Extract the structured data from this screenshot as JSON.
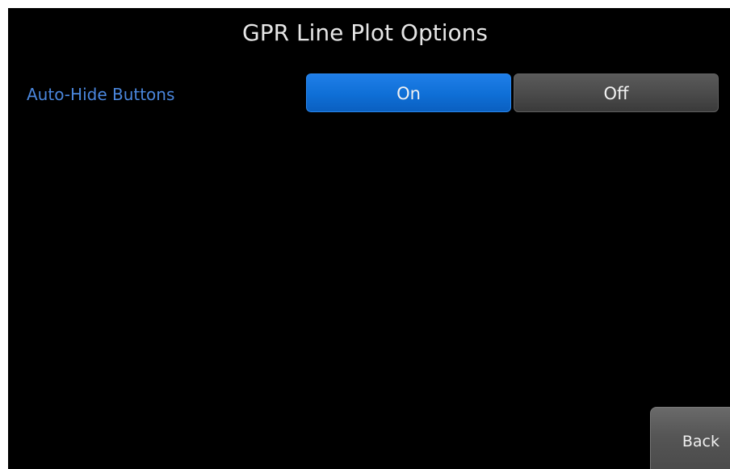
{
  "screen": {
    "title": "GPR Line Plot Options"
  },
  "settings": {
    "auto_hide": {
      "label": "Auto-Hide Buttons",
      "on_label": "On",
      "off_label": "Off",
      "selected": "On"
    }
  },
  "nav": {
    "back_label": "Back"
  },
  "colors": {
    "background": "#000000",
    "accent_selected": "#1575e0",
    "unselected": "#4a4a4a",
    "label_blue": "#4a86dc",
    "title_text": "#e6e6e6"
  }
}
